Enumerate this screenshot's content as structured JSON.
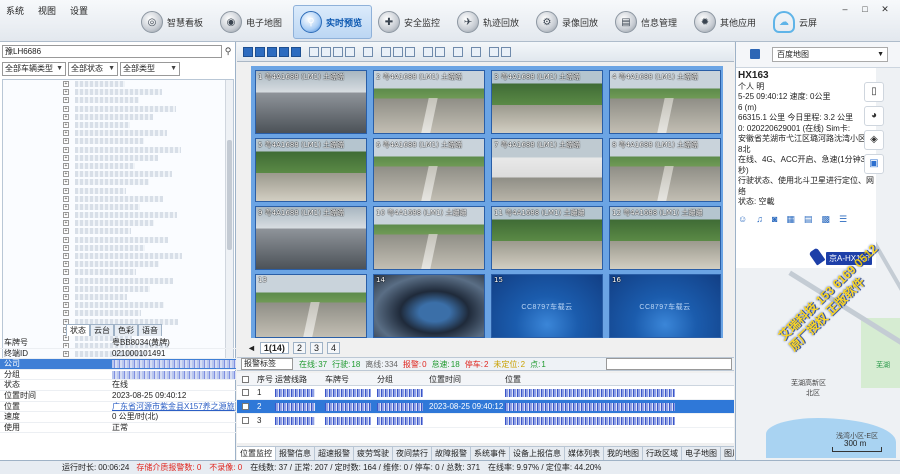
{
  "menu": [
    "系统",
    "视图",
    "设置"
  ],
  "window_controls": [
    "–",
    "□",
    "✕"
  ],
  "modules": [
    {
      "label": "智慧看板",
      "icon": "dashboard-icon",
      "glyph": "◎",
      "active": false
    },
    {
      "label": "电子地图",
      "icon": "map-icon",
      "glyph": "◉",
      "active": false
    },
    {
      "label": "实时预览",
      "icon": "search-icon",
      "glyph": "⚲",
      "active": true
    },
    {
      "label": "安全监控",
      "icon": "shield-icon",
      "glyph": "✚",
      "active": false
    },
    {
      "label": "轨迹回放",
      "icon": "track-icon",
      "glyph": "✈",
      "active": false
    },
    {
      "label": "录像回放",
      "icon": "record-icon",
      "glyph": "⚙",
      "active": false
    },
    {
      "label": "信息管理",
      "icon": "info-icon",
      "glyph": "▤",
      "active": false
    },
    {
      "label": "其他应用",
      "icon": "apps-icon",
      "glyph": "✹",
      "active": false
    },
    {
      "label": "云屏",
      "icon": "cloud-icon",
      "glyph": "☁",
      "active": false
    }
  ],
  "left": {
    "search_value": "豫LH6686",
    "filters": [
      "全部车辆类型",
      "全部状态",
      "全部类型"
    ],
    "info_tabs": [
      "状态",
      "云台",
      "色彩",
      "语音"
    ],
    "info_rows": [
      {
        "k": "车牌号",
        "v": "粤BB8034(黄牌)"
      },
      {
        "k": "终端ID",
        "v": "021000101491"
      },
      {
        "k": "公司",
        "v": "",
        "blur": true,
        "selected": true
      },
      {
        "k": "分组",
        "v": "",
        "blur": true
      },
      {
        "k": "状态",
        "v": "在线"
      },
      {
        "k": "位置时间",
        "v": "2023-08-25 09:40:12"
      },
      {
        "k": "位置",
        "v": "广东省河源市紫金县X157养之源旅",
        "link": true
      },
      {
        "k": "速度",
        "v": "0 公里/时(北)"
      },
      {
        "k": "使用",
        "v": "正常"
      }
    ]
  },
  "video": {
    "cells": [
      {
        "label": "1 粤4A1688 (LM1) 土蹦蹦",
        "scene": "cab"
      },
      {
        "label": "2 粤4A1688 (LM1) 土蹦蹦",
        "scene": "road"
      },
      {
        "label": "3 粤4A1688 (LM1) 土蹦蹦",
        "scene": "tree"
      },
      {
        "label": "4 粤4A1688 (LM1) 土蹦蹦",
        "scene": "road"
      },
      {
        "label": "5 粤4A1688 (LM1) 土蹦蹦",
        "scene": "tree"
      },
      {
        "label": "6 粤4A1688 (LM1) 土蹦蹦",
        "scene": "road"
      },
      {
        "label": "7 粤4A1688 (LM1) 土蹦蹦",
        "scene": "truck"
      },
      {
        "label": "8 粤4A1688 (LM1) 土蹦蹦",
        "scene": "road"
      },
      {
        "label": "9 粤4A1688 (LM1) 土蹦蹦",
        "scene": "cab"
      },
      {
        "label": "10 粤4A1688 (LM1) 土蹦蹦",
        "scene": "road"
      },
      {
        "label": "11 粤4A1688 (LM1) 土蹦蹦",
        "scene": "tree"
      },
      {
        "label": "12 粤4A1688 (LM1) 土蹦蹦",
        "scene": "tree"
      },
      {
        "label": "13",
        "scene": "road"
      },
      {
        "label": "14",
        "scene": "indoor"
      },
      {
        "label": "15",
        "scene": "nosig",
        "nosig": "CC8797车载云"
      },
      {
        "label": "16",
        "scene": "nosig",
        "nosig": "CC8797车载云"
      }
    ],
    "pages": [
      "1(14)",
      "2",
      "3",
      "4"
    ],
    "alarm_dropdown": "报警标签",
    "stats": [
      {
        "label": "在线:",
        "value": "37",
        "color": "#1f9a2e"
      },
      {
        "label": "行驶:",
        "value": "18",
        "color": "#1f9a2e"
      },
      {
        "label": "离线:",
        "value": "334",
        "color": "#666"
      },
      {
        "label": "报警:",
        "value": "0",
        "color": "#e0261f"
      },
      {
        "label": "怠速:",
        "value": "18",
        "color": "#1f9a2e"
      },
      {
        "label": "停车:",
        "value": "2",
        "color": "#e0261f"
      },
      {
        "label": "未定位:",
        "value": "2",
        "color": "#c9a100"
      },
      {
        "label": "点:",
        "value": "1",
        "color": "#1f9a2e"
      }
    ],
    "table_headers": [
      "",
      "序号",
      "运营线路",
      "车牌号",
      "分组",
      "位置时间",
      "位置"
    ],
    "table_rows": [
      {
        "idx": "1",
        "time": "",
        "selected": false
      },
      {
        "idx": "2",
        "time": "2023-08-25 09:40:12",
        "selected": true
      },
      {
        "idx": "3",
        "time": "",
        "selected": false
      }
    ],
    "bottom_tabs": [
      "位置监控",
      "报警信息",
      "超速报警",
      "疲劳驾驶",
      "夜间禁行",
      "故障报警",
      "系统事件",
      "设备上报信息",
      "媒体列表",
      "我的地图",
      "行政区域",
      "电子地图",
      "图片预览"
    ]
  },
  "map": {
    "provider": "百度地图",
    "popup": {
      "title": "HX163",
      "lines": [
        "个人 明",
        "5-25 09:40:12  速度: 0公里",
        "6 (m)",
        "66315.1 公里  今日里程: 3.2 公里",
        "0: 020220629001 (在线)  Sim卡:",
        "安徽省芜湖市弋江区璐河路沈湾小区",
        "8北",
        "在线、4G、ACC开启、急速(1分钟30秒)",
        "行驶状态、使用北斗卫星进行定位、网络",
        "状态: 空載"
      ],
      "icons": [
        "user-icon",
        "headset-icon",
        "camera-icon",
        "image-icon",
        "doc-icon",
        "grid-icon",
        "list-icon"
      ]
    },
    "car_label": "京A-HX163",
    "labels": {
      "district": "芜湖高新区",
      "subdistrict": "北区",
      "residential": "浅湾小区-E区",
      "park": "芜湖"
    },
    "scale": "300 m",
    "watermark": [
      "艾瑞科技 153 6169 0512",
      "原厂授权 正版软件"
    ]
  },
  "status": {
    "run_time_label": "运行时长:",
    "run_time": "00:06:24",
    "items": [
      {
        "text": "存储介质报警数: 0",
        "red": true
      },
      {
        "text": "不录像: 0",
        "red": true
      },
      {
        "text": "在线数: 37 / 正常: 207 / 定时数: 164 / 维修: 0 / 停车: 0 / 总数: 371",
        "red": false
      },
      {
        "text": "在线率: 9.97% / 定位率: 44.20%",
        "red": false
      }
    ]
  }
}
